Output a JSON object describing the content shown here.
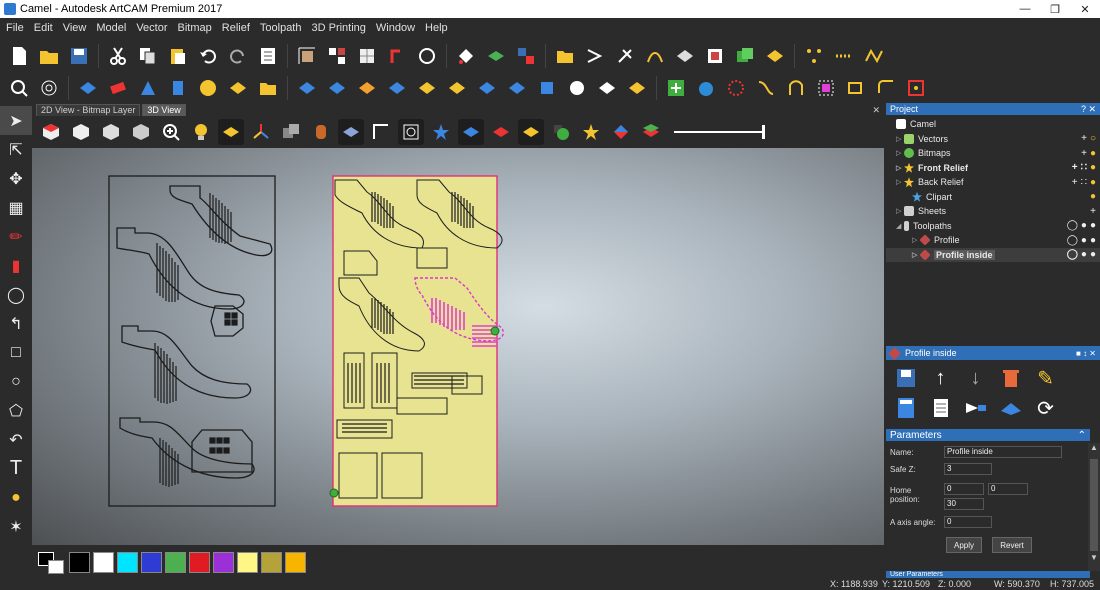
{
  "window": {
    "title": "Camel - Autodesk ArtCAM Premium 2017"
  },
  "menu": [
    "File",
    "Edit",
    "View",
    "Model",
    "Vector",
    "Bitmap",
    "Relief",
    "Toolpath",
    "3D Printing",
    "Window",
    "Help"
  ],
  "tabs": [
    {
      "label": "2D View - Bitmap Layer",
      "active": false
    },
    {
      "label": "3D View",
      "active": true
    }
  ],
  "project": {
    "header": "Project",
    "header_controls": "? ✕",
    "items": [
      {
        "label": "Camel",
        "icon": "document-icon",
        "color": "#ffffff",
        "bold": false,
        "arrow": ""
      },
      {
        "label": "Vectors",
        "icon": "vector-icon",
        "color": "#9ad36b",
        "bold": false,
        "arrow": "▷"
      },
      {
        "label": "Bitmaps",
        "icon": "bitmap-icon",
        "color": "#5fbf4a",
        "bold": false,
        "arrow": "▷"
      },
      {
        "label": "Front Relief",
        "icon": "relief-star-icon",
        "color": "#f4c430",
        "bold": true,
        "arrow": "▷"
      },
      {
        "label": "Back Relief",
        "icon": "relief-star-icon",
        "color": "#f4c430",
        "bold": false,
        "arrow": "▷"
      },
      {
        "label": "Clipart",
        "icon": "clipart-star-icon",
        "color": "#4aa3e0",
        "bold": false,
        "arrow": ""
      },
      {
        "label": "Sheets",
        "icon": "sheet-icon",
        "color": "#d0d0d0",
        "bold": false,
        "arrow": "▷"
      },
      {
        "label": "Toolpaths",
        "icon": "toolpath-icon",
        "color": "#d0d0d0",
        "bold": false,
        "arrow": "◢"
      },
      {
        "label": "Profile",
        "icon": "profile-icon",
        "color": "#c04a4a",
        "bold": false,
        "arrow": "▷"
      },
      {
        "label": "Profile inside",
        "icon": "profile-icon",
        "color": "#c04a4a",
        "bold": true,
        "arrow": "▷",
        "selected": true
      }
    ]
  },
  "profile_panel": {
    "header": "Profile inside"
  },
  "parameters": {
    "header": "Parameters",
    "name_label": "Name:",
    "name_value": "Profile inside",
    "safe_z_label": "Safe Z:",
    "safe_z_value": "3",
    "home_label": "Home\nposition:",
    "home_x": "0",
    "home_y": "0",
    "home_z": "30",
    "a_axis_label": "A axis angle:",
    "a_axis_value": "0",
    "apply_label": "Apply",
    "revert_label": "Revert"
  },
  "user_params_header": "User Parameters",
  "status": {
    "x": "X: 1188.939",
    "y": "Y: 1210.509",
    "z": "Z: 0.000",
    "w": "W: 590.370",
    "h": "H: 737.005"
  },
  "palette_colors": [
    "#000000",
    "#ffffff",
    "#00e5ff",
    "#2e3cd4",
    "#4caf50",
    "#e01b24",
    "#9b30d9",
    "#fff685",
    "#b5a33a",
    "#f7b500"
  ],
  "accent": "#2e6fb8"
}
